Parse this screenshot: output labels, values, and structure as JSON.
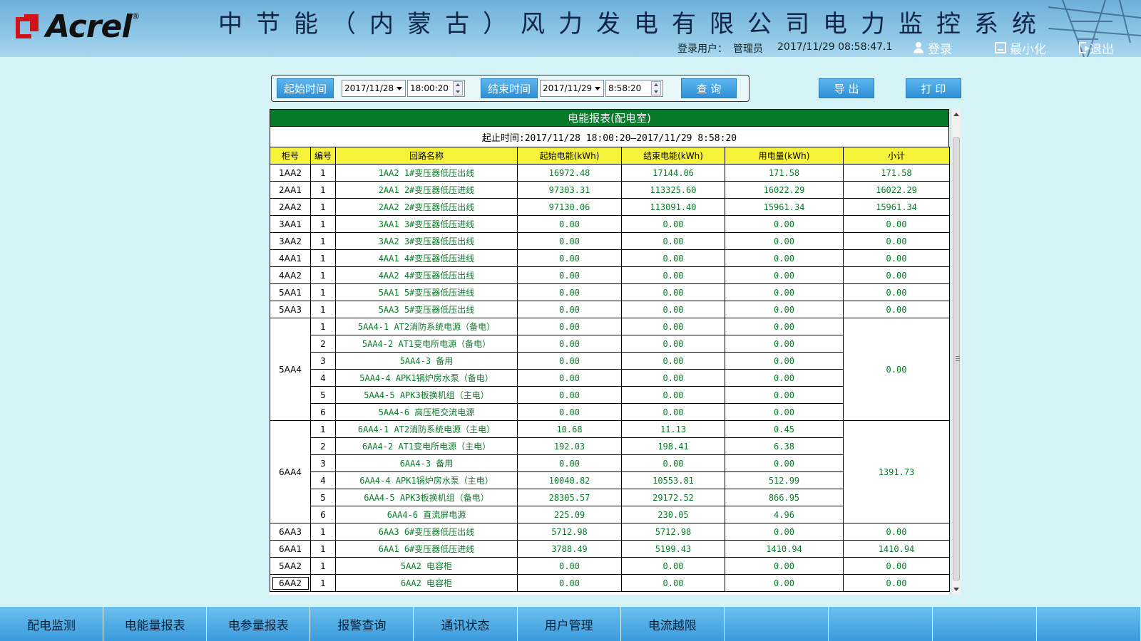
{
  "header": {
    "logo_text": "Acrel",
    "logo_reg": "®",
    "title": "中节能（内蒙古）风力发电有限公司电力监控系统",
    "login_label": "登录用户：",
    "login_user": "管理员",
    "datetime": "2017/11/29  08:58:47.1",
    "login_btn": "登录",
    "minimize_btn": "最小化",
    "exit_btn": "退出"
  },
  "query": {
    "start_label": "起始时间",
    "start_date": "2017/11/28",
    "start_time": "18:00:20",
    "end_label": "结束时间",
    "end_date": "2017/11/29",
    "end_time": "8:58:20",
    "query_btn": "查 询",
    "export_btn": "导 出",
    "print_btn": "打 印"
  },
  "report": {
    "title": "电能报表(配电室)",
    "range": "起止时间:2017/11/28 18:00:20—2017/11/29 8:58:20",
    "columns": [
      "柜号",
      "编号",
      "回路名称",
      "起始电能(kWh)",
      "结束电能(kWh)",
      "用电量(kWh)",
      "小计"
    ],
    "rows": [
      {
        "cab": "1AA2",
        "no": "1",
        "name": "1AA2 1#变压器低压出线",
        "start": "16972.48",
        "end": "17144.06",
        "use": "171.58",
        "sub": "171.58"
      },
      {
        "cab": "2AA1",
        "no": "1",
        "name": "2AA1 2#变压器低压进线",
        "start": "97303.31",
        "end": "113325.60",
        "use": "16022.29",
        "sub": "16022.29"
      },
      {
        "cab": "2AA2",
        "no": "1",
        "name": "2AA2 2#变压器低压出线",
        "start": "97130.06",
        "end": "113091.40",
        "use": "15961.34",
        "sub": "15961.34"
      },
      {
        "cab": "3AA1",
        "no": "1",
        "name": "3AA1 3#变压器低压进线",
        "start": "0.00",
        "end": "0.00",
        "use": "0.00",
        "sub": "0.00"
      },
      {
        "cab": "3AA2",
        "no": "1",
        "name": "3AA2 3#变压器低压出线",
        "start": "0.00",
        "end": "0.00",
        "use": "0.00",
        "sub": "0.00"
      },
      {
        "cab": "4AA1",
        "no": "1",
        "name": "4AA1 4#变压器低压进线",
        "start": "0.00",
        "end": "0.00",
        "use": "0.00",
        "sub": "0.00"
      },
      {
        "cab": "4AA2",
        "no": "1",
        "name": "4AA2 4#变压器低压出线",
        "start": "0.00",
        "end": "0.00",
        "use": "0.00",
        "sub": "0.00"
      },
      {
        "cab": "5AA1",
        "no": "1",
        "name": "5AA1 5#变压器低压进线",
        "start": "0.00",
        "end": "0.00",
        "use": "0.00",
        "sub": "0.00"
      },
      {
        "cab": "5AA3",
        "no": "1",
        "name": "5AA3 5#变压器低压出线",
        "start": "0.00",
        "end": "0.00",
        "use": "0.00",
        "sub": "0.00"
      },
      {
        "cab": "5AA4",
        "no": "1",
        "name": "5AA4-1 AT2消防系统电源（备电）",
        "start": "0.00",
        "end": "0.00",
        "use": "0.00",
        "sub": "0.00"
      },
      {
        "cab": "",
        "no": "2",
        "name": "5AA4-2 AT1变电所电源（备电）",
        "start": "0.00",
        "end": "0.00",
        "use": "0.00",
        "sub": ""
      },
      {
        "cab": "",
        "no": "3",
        "name": "5AA4-3 备用",
        "start": "0.00",
        "end": "0.00",
        "use": "0.00",
        "sub": ""
      },
      {
        "cab": "",
        "no": "4",
        "name": "5AA4-4 APK1锅炉房水泵（备电）",
        "start": "0.00",
        "end": "0.00",
        "use": "0.00",
        "sub": ""
      },
      {
        "cab": "",
        "no": "5",
        "name": "5AA4-5 APK3板换机组（主电）",
        "start": "0.00",
        "end": "0.00",
        "use": "0.00",
        "sub": ""
      },
      {
        "cab": "",
        "no": "6",
        "name": "5AA4-6 高压柜交流电源",
        "start": "0.00",
        "end": "0.00",
        "use": "0.00",
        "sub": ""
      },
      {
        "cab": "6AA4",
        "no": "1",
        "name": "6AA4-1 AT2消防系统电源（主电）",
        "start": "10.68",
        "end": "11.13",
        "use": "0.45",
        "sub": "1391.73"
      },
      {
        "cab": "",
        "no": "2",
        "name": "6AA4-2 AT1变电所电源（主电）",
        "start": "192.03",
        "end": "198.41",
        "use": "6.38",
        "sub": ""
      },
      {
        "cab": "",
        "no": "3",
        "name": "6AA4-3 备用",
        "start": "0.00",
        "end": "0.00",
        "use": "0.00",
        "sub": ""
      },
      {
        "cab": "",
        "no": "4",
        "name": "6AA4-4 APK1锅炉房水泵（主电）",
        "start": "10040.82",
        "end": "10553.81",
        "use": "512.99",
        "sub": ""
      },
      {
        "cab": "",
        "no": "5",
        "name": "6AA4-5 APK3板换机组（备电）",
        "start": "28305.57",
        "end": "29172.52",
        "use": "866.95",
        "sub": ""
      },
      {
        "cab": "",
        "no": "6",
        "name": "6AA4-6 直流屏电源",
        "start": "225.09",
        "end": "230.05",
        "use": "4.96",
        "sub": ""
      },
      {
        "cab": "6AA3",
        "no": "1",
        "name": "6AA3 6#变压器低压出线",
        "start": "5712.98",
        "end": "5712.98",
        "use": "0.00",
        "sub": "0.00"
      },
      {
        "cab": "6AA1",
        "no": "1",
        "name": "6AA1 6#变压器低压进线",
        "start": "3788.49",
        "end": "5199.43",
        "use": "1410.94",
        "sub": "1410.94"
      },
      {
        "cab": "5AA2",
        "no": "1",
        "name": "5AA2 电容柜",
        "start": "0.00",
        "end": "0.00",
        "use": "0.00",
        "sub": "0.00"
      },
      {
        "cab": "6AA2",
        "no": "1",
        "name": "6AA2 电容柜",
        "start": "0.00",
        "end": "0.00",
        "use": "0.00",
        "sub": "0.00"
      }
    ]
  },
  "nav": [
    "配电监测",
    "电能量报表",
    "电参量报表",
    "报警查询",
    "通讯状态",
    "用户管理",
    "电流越限",
    "",
    "",
    "",
    ""
  ],
  "colors": {
    "title_green": "#087b2a",
    "header_yellow": "#f6f23a",
    "value_green": "#0a7a28",
    "button_blue": "#2f8fd6"
  }
}
